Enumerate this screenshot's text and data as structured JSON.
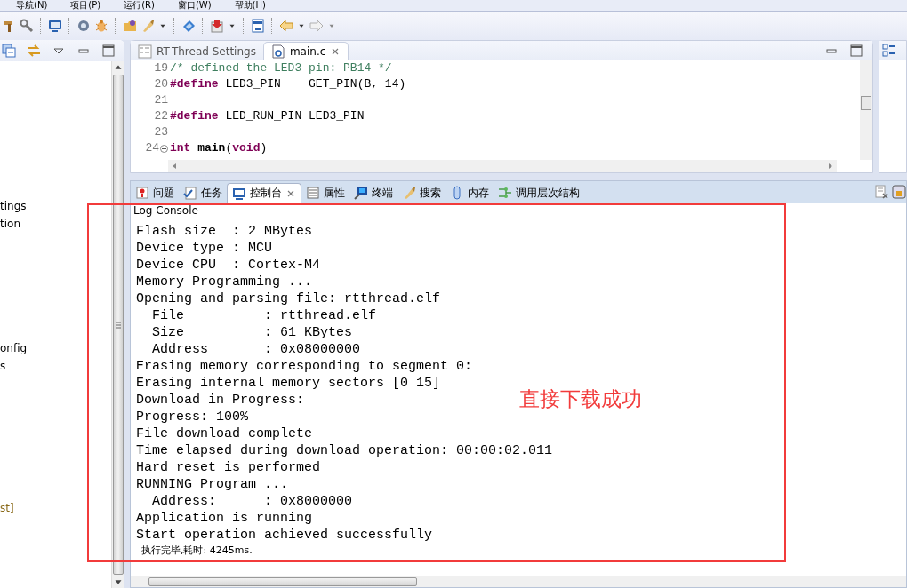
{
  "menu_bar": [
    "导航(N)",
    "项目(P)",
    "运行(R)",
    "窗口(W)",
    "帮助(H)"
  ],
  "project_explorer": {
    "items": [
      {
        "label": "tings",
        "kind": "plain"
      },
      {
        "label": "tion",
        "kind": "plain"
      },
      {
        "label": "onfig",
        "kind": "plain"
      },
      {
        "label": "s",
        "kind": "plain"
      },
      {
        "label": "st]",
        "kind": "decorated"
      }
    ]
  },
  "editor": {
    "tabs": [
      {
        "label": "RT-Thread Settings",
        "selected": false,
        "closable": false
      },
      {
        "label": "main.c",
        "selected": true,
        "closable": true
      }
    ],
    "lines": [
      {
        "number": "19",
        "tokens": [
          {
            "text": "/* defined the LED3 pin: PB14 */",
            "kind": "comment"
          }
        ]
      },
      {
        "number": "20",
        "tokens": [
          {
            "text": "#define",
            "kind": "directive"
          },
          {
            "text": " LED3_PIN    GET_PIN(B, 14)",
            "kind": "plain"
          }
        ]
      },
      {
        "number": "21"
      },
      {
        "number": "22",
        "tokens": [
          {
            "text": "#define",
            "kind": "directive"
          },
          {
            "text": " LED_RUN_PIN LED3_PIN",
            "kind": "plain"
          }
        ]
      },
      {
        "number": "23"
      },
      {
        "number": "24",
        "folded": false,
        "tokens": [
          {
            "text": "int",
            "kind": "keyword"
          },
          {
            "text": " main",
            "kind": "function"
          },
          {
            "text": "(",
            "kind": "plain"
          },
          {
            "text": "void",
            "kind": "keyword"
          },
          {
            "text": ")",
            "kind": "plain"
          }
        ]
      }
    ]
  },
  "console": {
    "tabs": [
      {
        "label": "问题",
        "selected": false,
        "closable": false
      },
      {
        "label": "任务",
        "selected": false,
        "closable": false
      },
      {
        "label": "控制台",
        "selected": true,
        "closable": true
      },
      {
        "label": "属性",
        "selected": false,
        "closable": false
      },
      {
        "label": "终端",
        "selected": false,
        "closable": false
      },
      {
        "label": "搜索",
        "selected": false,
        "closable": false
      },
      {
        "label": "内存",
        "selected": false,
        "closable": false
      },
      {
        "label": "调用层次结构",
        "selected": false,
        "closable": false
      }
    ],
    "title": "Log Console",
    "lines": [
      "Flash size  : 2 MBytes",
      "Device type : MCU",
      "Device CPU  : Cortex-M4",
      "Memory Programming ...",
      "Opening and parsing file: rtthread.elf",
      "  File          : rtthread.elf",
      "  Size          : 61 KBytes",
      "  Address       : 0x08000000",
      "Erasing memory corresponding to segment 0:",
      "Erasing internal memory sectors [0 15]",
      "Download in Progress:",
      "Progress: 100%",
      "File download complete",
      "Time elapsed during download operation: 00:00:02.011",
      "Hard reset is performed",
      "RUNNING Program ...",
      "  Address:      : 0x8000000",
      "Application is running",
      "Start operation achieved successfully"
    ],
    "status": "执行完毕,耗时: 4245ms.",
    "annotation": "直接下载成功"
  }
}
